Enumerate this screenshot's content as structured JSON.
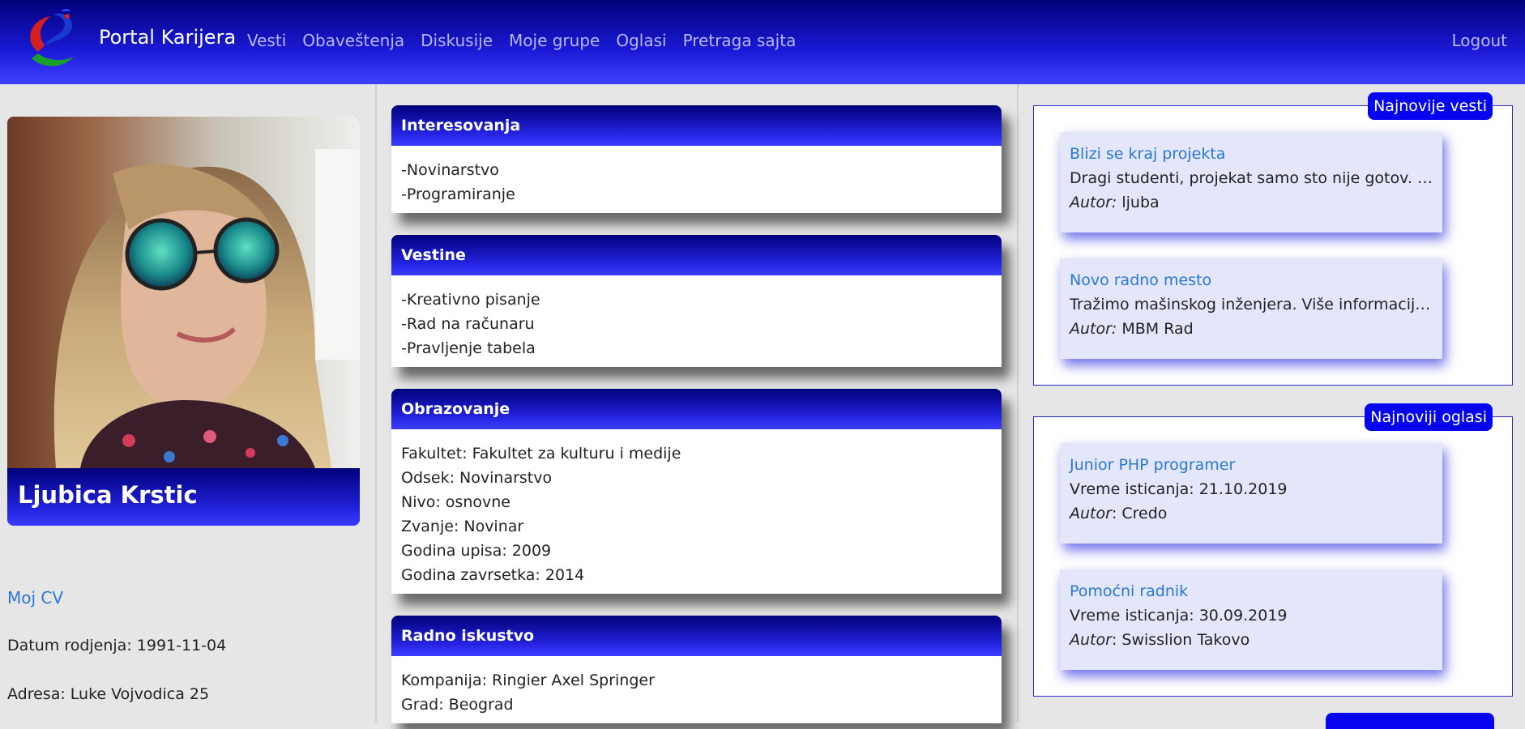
{
  "navbar": {
    "brand": "Portal Karijera",
    "links": [
      "Vesti",
      "Obaveštenja",
      "Diskusije",
      "Moje grupe",
      "Oglasi",
      "Pretraga sajta"
    ],
    "logout": "Logout"
  },
  "profile": {
    "name": "Ljubica Krstic",
    "cv_link": "Moj CV",
    "birth_date": "Datum rodjenja: 1991-11-04",
    "address": "Adresa: Luke Vojvodica 25"
  },
  "cards": {
    "interests": {
      "title": "Interesovanja",
      "lines": [
        "-Novinarstvo",
        "-Programiranje"
      ]
    },
    "skills": {
      "title": "Vestine",
      "lines": [
        "-Kreativno pisanje",
        "-Rad na računaru",
        "-Pravljenje tabela"
      ]
    },
    "education": {
      "title": "Obrazovanje",
      "lines": [
        "Fakultet: Fakultet za kulturu i medije",
        "Odsek: Novinarstvo",
        "Nivo: osnovne",
        "Zvanje: Novinar",
        "Godina upisa: 2009",
        "Godina zavrsetka: 2014"
      ]
    },
    "experience": {
      "title": "Radno iskustvo",
      "lines": [
        "Kompanija: Ringier Axel Springer",
        "Grad: Beograd"
      ]
    }
  },
  "news": {
    "badge": "Najnovije vesti",
    "items": [
      {
        "title": "Blizi se kraj projekta",
        "text": "Dragi studenti, projekat samo sto nije gotov. Bilo...",
        "author_label": "Autor:",
        "author": " ljuba"
      },
      {
        "title": "Novo radno mesto",
        "text": "Tražimo mašinskog inženjera. Više informacija na...",
        "author_label": "Autor:",
        "author": " MBM Rad"
      }
    ]
  },
  "ads": {
    "badge": "Najnoviji oglasi",
    "items": [
      {
        "title": "Junior PHP programer",
        "text": "Vreme isticanja: 21.10.2019",
        "author_label": "Autor",
        "author": ": Credo"
      },
      {
        "title": "Pomoćni radnik",
        "text": "Vreme isticanja: 30.09.2019",
        "author_label": "Autor",
        "author": ": Swisslion Takovo"
      }
    ]
  },
  "colors": {
    "accent": "#0505ee",
    "link": "#2a78d6",
    "nav_link": "#b7b7ff"
  }
}
